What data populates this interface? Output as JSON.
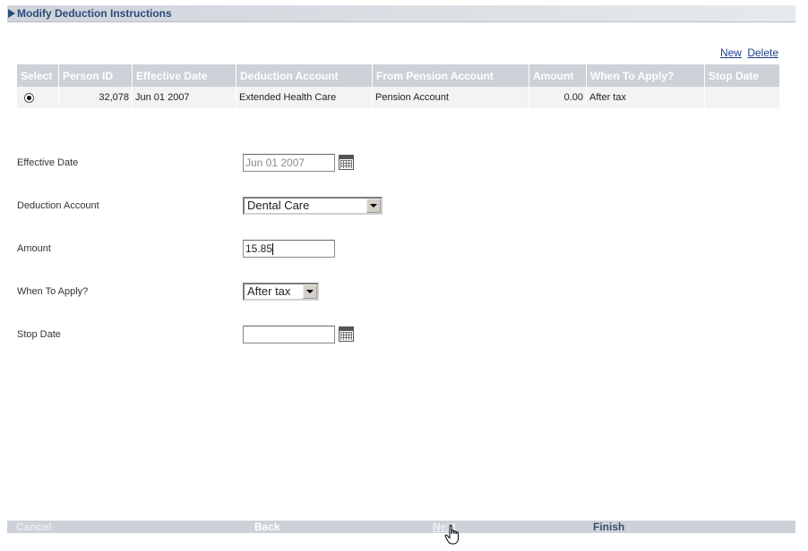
{
  "header": {
    "title": "Modify Deduction Instructions"
  },
  "links": {
    "new": "New",
    "delete": "Delete"
  },
  "table": {
    "columns": [
      "Select",
      "Person ID",
      "Effective Date",
      "Deduction Account",
      "From Pension Account",
      "Amount",
      "When To Apply?",
      "Stop Date"
    ],
    "rows": [
      {
        "selected": true,
        "person_id": "32,078",
        "effective_date": "Jun 01 2007",
        "deduction_account": "Extended Health Care",
        "from_pension_account": "Pension Account",
        "amount": "0.00",
        "when_to_apply": "After tax",
        "stop_date": ""
      }
    ]
  },
  "form": {
    "effective_date": {
      "label": "Effective Date",
      "value": "Jun 01 2007"
    },
    "deduction_account": {
      "label": "Deduction Account",
      "value": "Dental Care"
    },
    "amount": {
      "label": "Amount",
      "value": "15.85"
    },
    "when_to_apply": {
      "label": "When To Apply?",
      "value": "After tax"
    },
    "stop_date": {
      "label": "Stop Date",
      "value": ""
    }
  },
  "footer": {
    "cancel": "Cancel",
    "back": "Back",
    "next": "Next",
    "finish": "Finish"
  }
}
